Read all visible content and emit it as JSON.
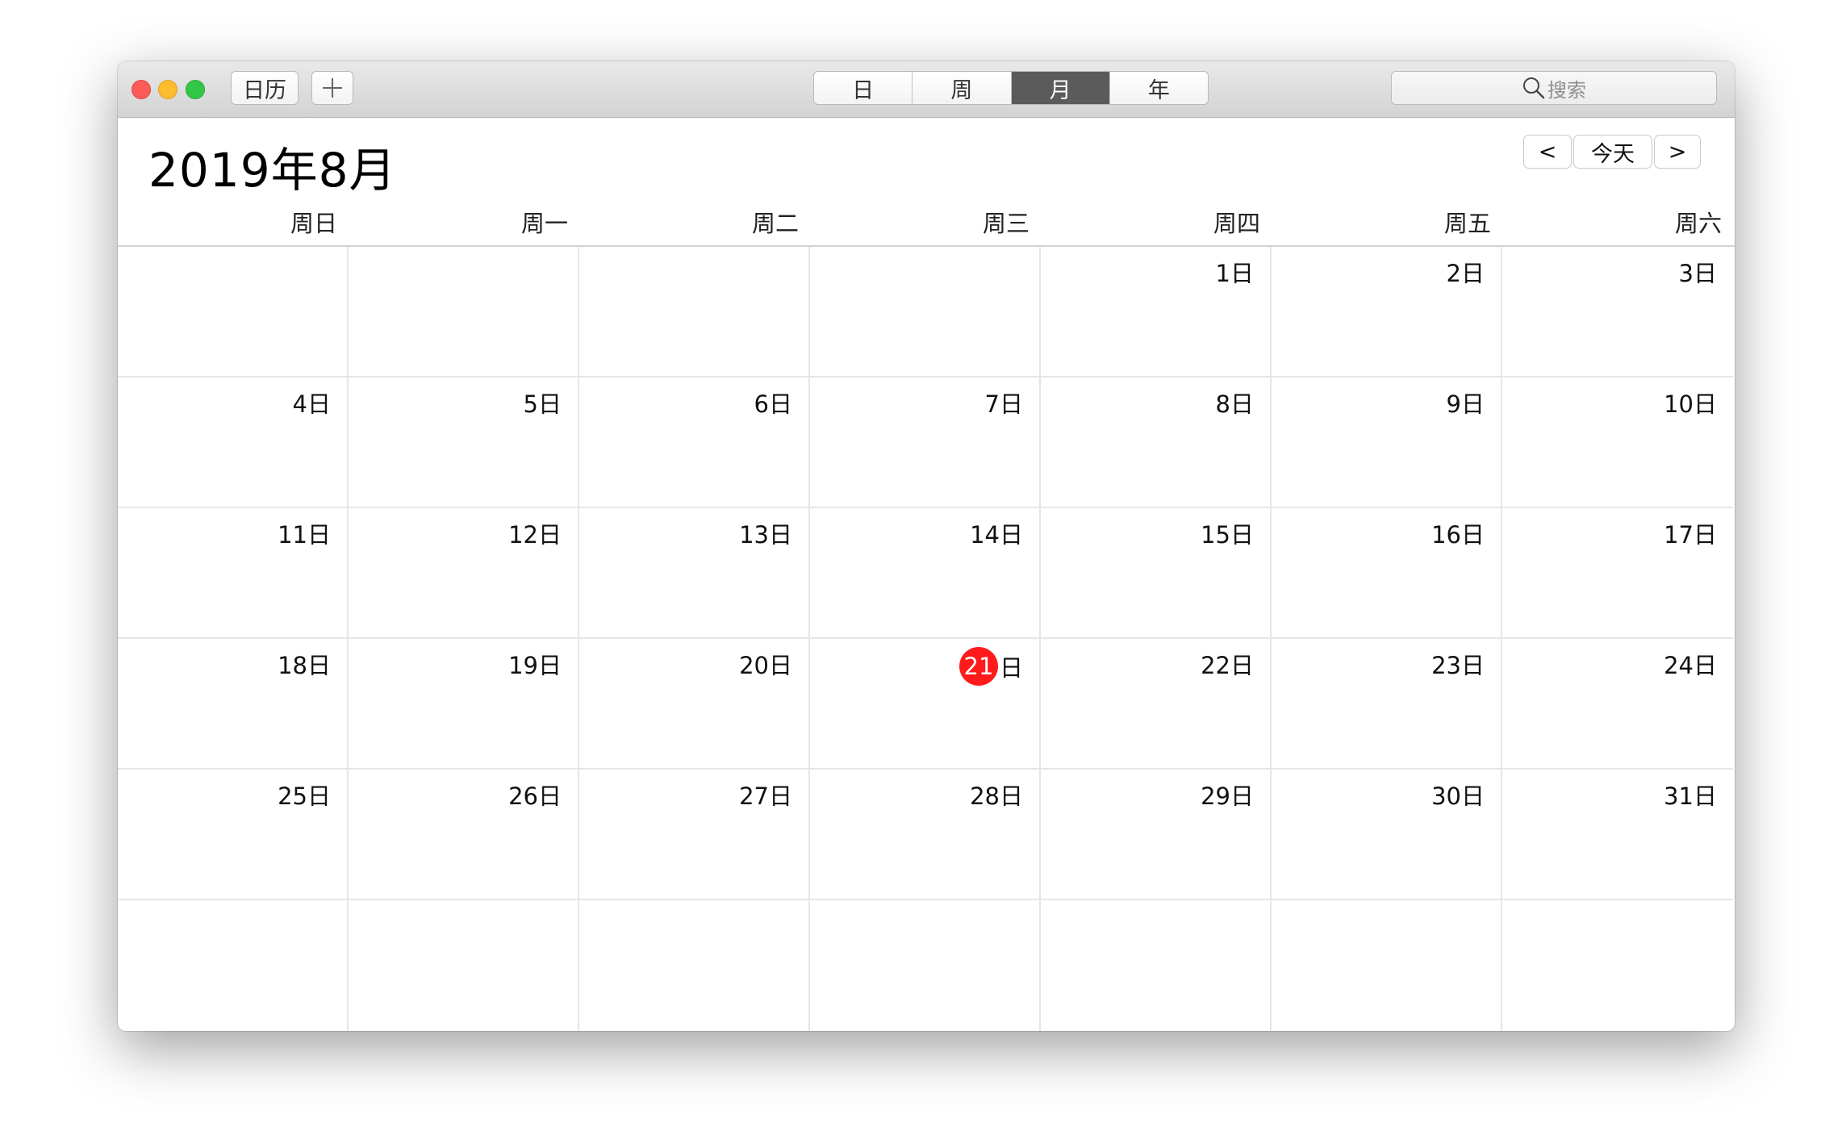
{
  "toolbar": {
    "calendars_label": "日历",
    "view_tabs": [
      {
        "label": "日",
        "active": false
      },
      {
        "label": "周",
        "active": false
      },
      {
        "label": "月",
        "active": true
      },
      {
        "label": "年",
        "active": false
      }
    ],
    "search_placeholder": "搜索"
  },
  "header": {
    "month_title": "2019年8月",
    "prev_label": "<",
    "today_label": "今天",
    "next_label": ">"
  },
  "weekdays": [
    "周日",
    "周一",
    "周二",
    "周三",
    "周四",
    "周五",
    "周六"
  ],
  "today": {
    "day_number": "21",
    "suffix": "日"
  },
  "colors": {
    "today_accent": "#ff1b1b",
    "active_tab": "#5b5b5b",
    "close": "#fc5b57",
    "minimize": "#fdbc2e",
    "maximize": "#33c748"
  },
  "days": [
    "",
    "",
    "",
    "",
    "1日",
    "2日",
    "3日",
    "4日",
    "5日",
    "6日",
    "7日",
    "8日",
    "9日",
    "10日",
    "11日",
    "12日",
    "13日",
    "14日",
    "15日",
    "16日",
    "17日",
    "18日",
    "19日",
    "20日",
    "21日",
    "22日",
    "23日",
    "24日",
    "25日",
    "26日",
    "27日",
    "28日",
    "29日",
    "30日",
    "31日",
    "",
    "",
    "",
    "",
    "",
    "",
    ""
  ]
}
